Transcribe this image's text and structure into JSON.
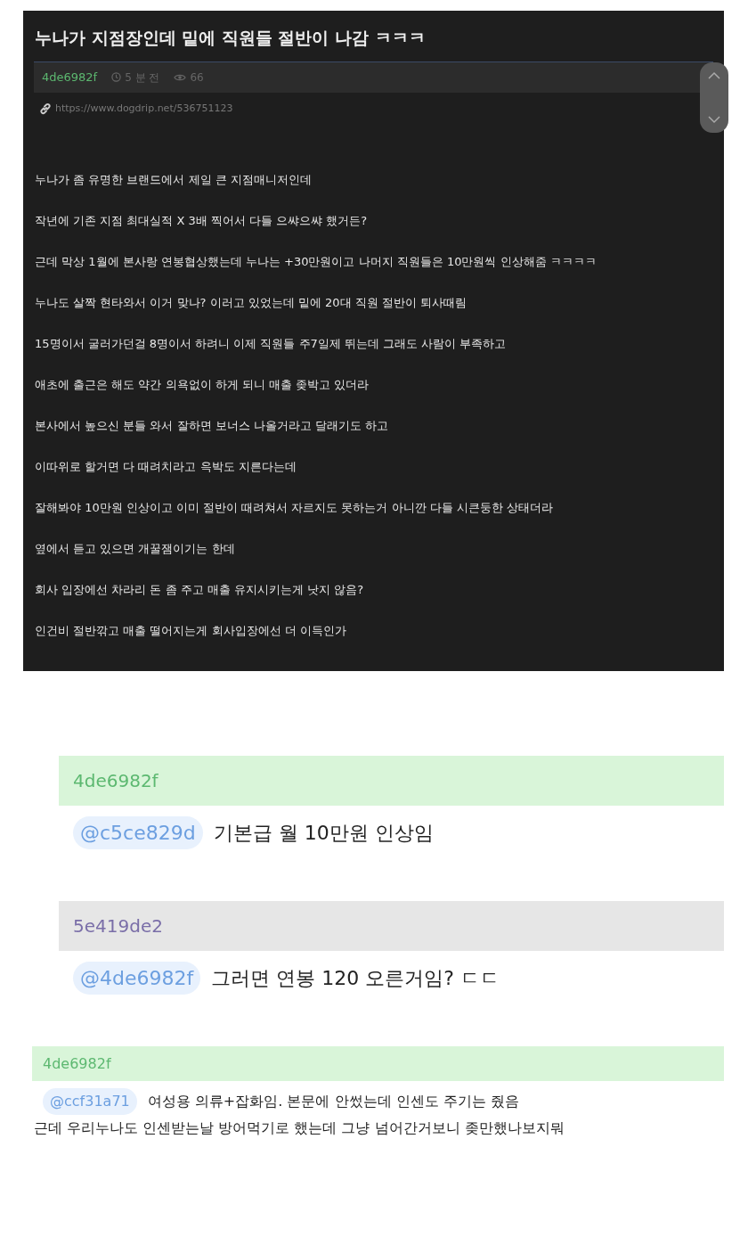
{
  "post": {
    "title": "누나가 지점장인데 밑에 직원들 절반이 나감 ㅋㅋㅋ",
    "author": "4de6982f",
    "time": "5 분 전",
    "views": "66",
    "url": "https://www.dogdrip.net/536751123",
    "paragraphs": [
      "누나가 좀 유명한 브랜드에서 제일 큰 지점매니저인데",
      "작년에 기존 지점 최대실적 X 3배 찍어서 다들 으쌰으쌰 했거든?",
      "근데 막상 1월에 본사랑 연봉협상했는데 누나는 +30만원이고 나머지 직원들은 10만원씩 인상해줌 ㅋㅋㅋㅋ",
      "누나도 살짝 현타와서 이거 맞나? 이러고 있었는데 밑에 20대 직원 절반이 퇴사때림",
      "15명이서 굴러가던걸 8명이서 하려니 이제 직원들 주7일제 뛰는데 그래도 사람이 부족하고",
      "애초에 출근은 해도 약간 의욕없이 하게 되니 매출 좆박고 있더라",
      "본사에서 높으신 분들 와서 잘하면 보너스 나올거라고 달래기도 하고",
      "이따위로 할거면 다 때려치라고 윽박도 지른다는데",
      "잘해봐야 10만원 인상이고 이미 절반이 때려쳐서 자르지도 못하는거 아니깐 다들 시큰둥한 상태더라",
      "옆에서 듣고 있으면 개꿀잼이기는 한데",
      "회사 입장에선 차라리 돈 좀 주고 매출 유지시키는게 낫지 않음?",
      "인건비 절반깎고 매출 떨어지는게 회사입장에선 더 이득인가"
    ]
  },
  "comments": [
    {
      "kind": "large",
      "author": "4de6982f",
      "color": "#d9f5d9",
      "mention": "@c5ce829d",
      "lines": [
        "기본급 월 10만원 인상임"
      ]
    },
    {
      "kind": "large",
      "author": "5e419de2",
      "color": "#e6e6e6",
      "mention": "@4de6982f",
      "lines": [
        "그러면 연봉 120 오른거임? ㄷㄷ"
      ]
    },
    {
      "kind": "small",
      "author": "4de6982f",
      "color": "#d9f5d9",
      "mention": "@ccf31a71",
      "lines": [
        "여성용 의류+잡화임. 본문에 안썼는데 인센도 주기는 줬음",
        "근데 우리누나도 인센받는날 방어먹기로 했는데 그냥 넘어간거보니 좆만했나보지뭐"
      ]
    }
  ]
}
